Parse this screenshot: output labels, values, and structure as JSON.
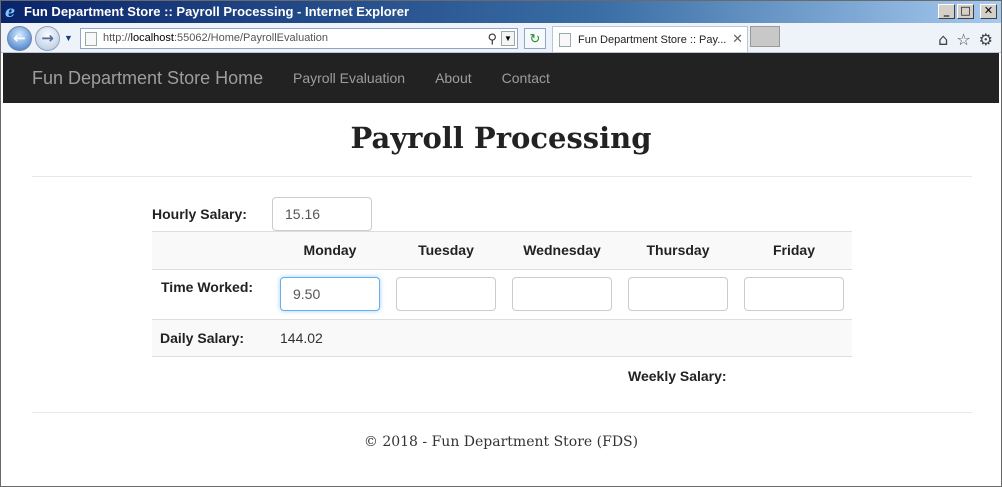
{
  "window": {
    "title": "Fun Department Store :: Payroll Processing - Internet Explorer",
    "controls": {
      "minimize": "_",
      "maximize": "□",
      "close": "✕"
    }
  },
  "browser": {
    "url_prefix": "http://",
    "url_host": "localhost",
    "url_rest": ":55062/Home/PayrollEvaluation",
    "tab_label": "Fun Department Store :: Pay...",
    "tab_close": "✕"
  },
  "nav": {
    "brand": "Fun Department Store Home",
    "links": [
      "Payroll Evaluation",
      "About",
      "Contact"
    ]
  },
  "page": {
    "title": "Payroll Processing",
    "hourly_label": "Hourly Salary:",
    "hourly_value": "15.16",
    "days": [
      "Monday",
      "Tuesday",
      "Wednesday",
      "Thursday",
      "Friday"
    ],
    "time_worked_label": "Time Worked:",
    "time_worked": [
      "9.50",
      "",
      "",
      "",
      ""
    ],
    "daily_salary_label": "Daily Salary:",
    "daily_salary": "144.02",
    "weekly_salary_label": "Weekly Salary:"
  },
  "footer": {
    "text": "© 2018 - Fun Department Store (FDS)"
  },
  "colors": {
    "navbar": "#222222",
    "nav_text": "#9d9d9d",
    "focus_border": "#66afe9"
  }
}
